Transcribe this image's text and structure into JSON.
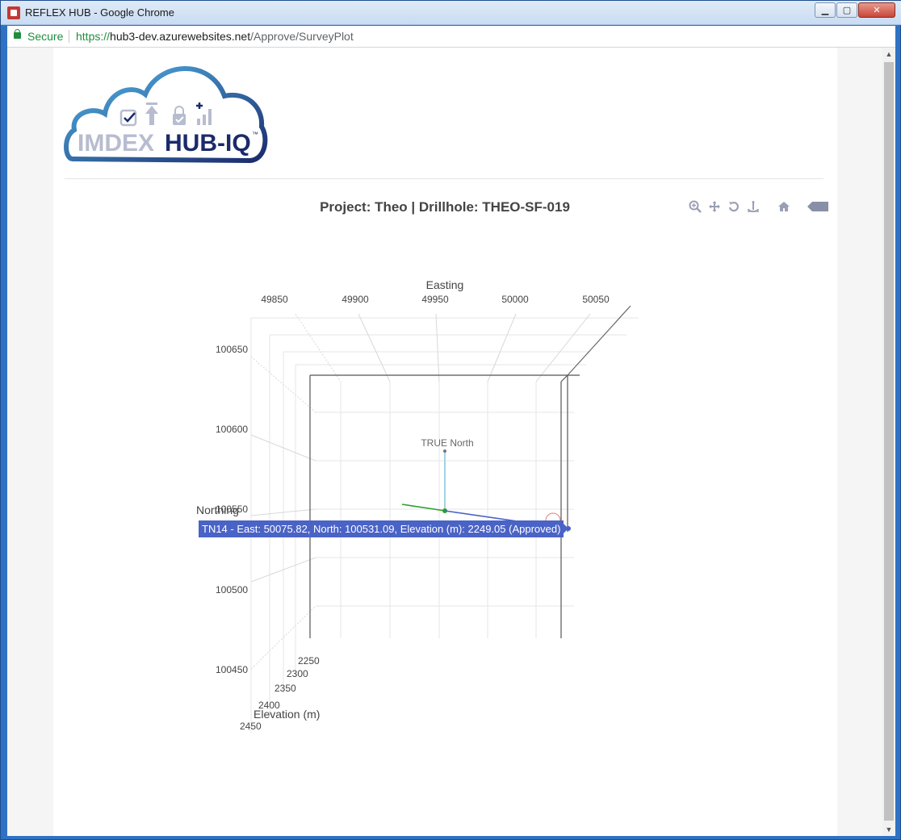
{
  "window": {
    "title": "REFLEX HUB - Google Chrome",
    "minimize_label": "▁",
    "maximize_label": "▢",
    "close_label": "✕"
  },
  "addressbar": {
    "secure_label": "Secure",
    "url_scheme": "https://",
    "url_host": "hub3-dev.azurewebsites.net",
    "url_path": "/Approve/SurveyPlot"
  },
  "logo": {
    "text_left": "IMDEX",
    "text_right": "HUB-IQ",
    "trademark": "™"
  },
  "plot": {
    "title": "Project: Theo | Drillhole: THEO-SF-019",
    "modebar": [
      "zoom-icon",
      "pan-icon",
      "orbit-rotation-icon",
      "turntable-rotation-icon",
      "reset-camera-icon",
      "plotly-logo"
    ],
    "true_north_label": "TRUE North",
    "tooltip": "TN14 - East: 50075.82, North: 100531.09, Elevation (m): 2249.05 (Approved)",
    "colors": {
      "trace": "#4a63c6",
      "azimuth": "#2ca02c",
      "north": "#9fd3e6",
      "tooltip_bg": "#4a63c6"
    }
  },
  "chart_data": {
    "type": "scatter3d",
    "title": "Project: Theo | Drillhole: THEO-SF-019",
    "axes": {
      "x": {
        "label": "Easting",
        "ticks": [
          "49850",
          "49900",
          "49950",
          "50000",
          "50050"
        ]
      },
      "y": {
        "label": "Northing",
        "ticks": [
          "100650",
          "100600",
          "100550",
          "100500",
          "100450"
        ]
      },
      "z": {
        "label": "Elevation (m)",
        "ticks": [
          "2250",
          "2300",
          "2350",
          "2400",
          "2450"
        ]
      }
    },
    "annotations": [
      "TRUE North"
    ],
    "hover_point": {
      "name": "TN14",
      "east": 50075.82,
      "north": 100531.09,
      "elevation": 2249.05,
      "status": "Approved"
    }
  }
}
